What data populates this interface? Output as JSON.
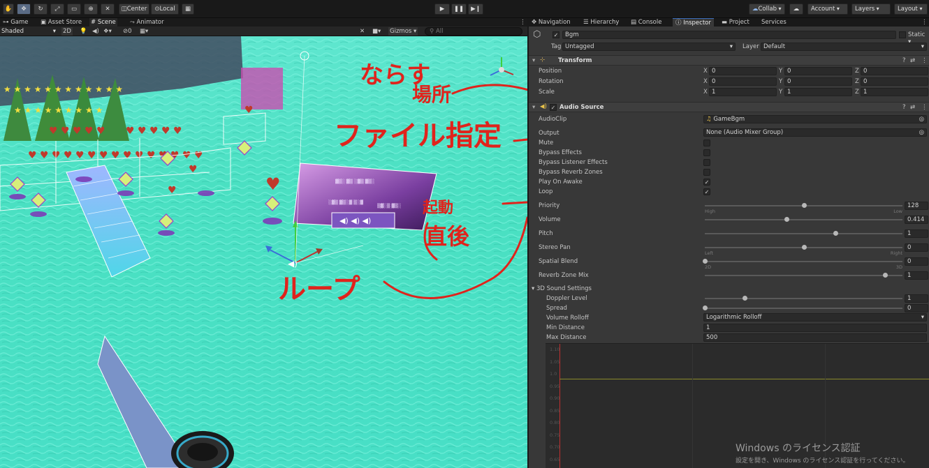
{
  "toolbar": {
    "pivot_label": "Center",
    "space_label": "Local",
    "collab_label": "Collab",
    "account_label": "Account",
    "layers_label": "Layers",
    "layout_label": "Layout",
    "play_icon": "play-icon",
    "pause_icon": "pause-icon",
    "step_icon": "step-icon"
  },
  "left_tabs": [
    "Game",
    "Asset Store",
    "Scene",
    "Animator"
  ],
  "scene_bar": {
    "shading": "Shaded",
    "mode_2d": "2D",
    "hidden_count": "0",
    "gizmos": "Gizmos",
    "search_placeholder": "All"
  },
  "inspector_tabs": [
    "Navigation",
    "Hierarchy",
    "Console",
    "Inspector",
    "Project",
    "Services"
  ],
  "object": {
    "name": "Bgm",
    "static_label": "Static",
    "tag_label": "Tag",
    "tag_value": "Untagged",
    "layer_label": "Layer",
    "layer_value": "Default"
  },
  "transform": {
    "title": "Transform",
    "rows": [
      {
        "label": "Position",
        "x": "0",
        "y": "0",
        "z": "0"
      },
      {
        "label": "Rotation",
        "x": "0",
        "y": "0",
        "z": "0"
      },
      {
        "label": "Scale",
        "x": "1",
        "y": "1",
        "z": "1"
      }
    ]
  },
  "audio_source": {
    "title": "Audio Source",
    "audio_clip_label": "AudioClip",
    "audio_clip_value": "GameBgm",
    "output_label": "Output",
    "output_value": "None (Audio Mixer Group)",
    "toggles": [
      {
        "label": "Mute",
        "checked": false
      },
      {
        "label": "Bypass Effects",
        "checked": false
      },
      {
        "label": "Bypass Listener Effects",
        "checked": false
      },
      {
        "label": "Bypass Reverb Zones",
        "checked": false
      },
      {
        "label": "Play On Awake",
        "checked": true
      },
      {
        "label": "Loop",
        "checked": true
      }
    ],
    "sliders": [
      {
        "label": "Priority",
        "value": "128",
        "pos": 0.5,
        "left_hint": "High",
        "right_hint": "Low"
      },
      {
        "label": "Volume",
        "value": "0.414",
        "pos": 0.414
      },
      {
        "label": "Pitch",
        "value": "1",
        "pos": 0.66
      },
      {
        "label": "Stereo Pan",
        "value": "0",
        "pos": 0.5,
        "left_hint": "Left",
        "right_hint": "Right"
      },
      {
        "label": "Spatial Blend",
        "value": "0",
        "pos": 0.0,
        "left_hint": "2D",
        "right_hint": "3D"
      },
      {
        "label": "Reverb Zone Mix",
        "value": "1",
        "pos": 0.91
      }
    ],
    "sound3d": {
      "title": "3D Sound Settings",
      "doppler_label": "Doppler Level",
      "doppler_value": "1",
      "doppler_pos": 0.2,
      "spread_label": "Spread",
      "spread_value": "0",
      "spread_pos": 0.0,
      "rolloff_label": "Volume Rolloff",
      "rolloff_value": "Logarithmic Rolloff",
      "min_label": "Min Distance",
      "min_value": "1",
      "max_label": "Max Distance",
      "max_value": "500"
    },
    "curve_ticks": [
      "1.10",
      "1.05",
      "1.0",
      "0.95",
      "0.90",
      "0.85",
      "0.80",
      "0.75",
      "0.70",
      "0.65"
    ]
  },
  "watermark": {
    "title": "Windows のライセンス認証",
    "subtitle": "設定を開き、Windows のライセンス認証を行ってください。"
  },
  "annotations": {
    "narasu": "ならす",
    "basho": "場所",
    "file": "ファイル指定",
    "loop": "ループ",
    "kido": "起動",
    "chokugo": "直後"
  }
}
